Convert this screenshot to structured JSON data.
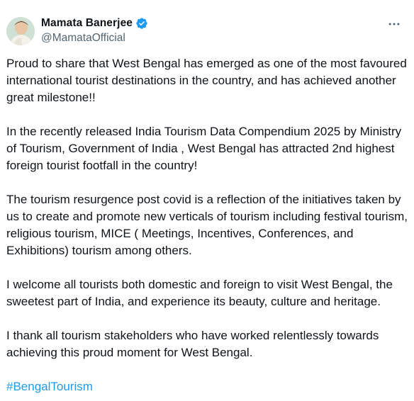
{
  "author": {
    "display_name": "Mamata Banerjee",
    "handle": "@MamataOfficial",
    "verified_color": "#1d9bf0"
  },
  "more_icon": "more-horizontal-icon",
  "tweet": {
    "paragraphs": [
      "Proud to share that West Bengal has emerged as one of the most favoured international tourist destinations in the country, and has achieved another great milestone!!",
      "In the recently released India Tourism Data Compendium 2025 by Ministry of Tourism, Government of India , West Bengal has attracted 2nd highest foreign tourist footfall in the country!",
      "The tourism resurgence post covid is a reflection of the initiatives taken by us to create and promote new verticals of tourism including festival tourism, religious tourism, MICE ( Meetings, Incentives, Conferences, and Exhibitions) tourism among others.",
      "I welcome all tourists both domestic and foreign to visit West Bengal, the sweetest part of India, and experience its beauty, culture and heritage.",
      "I thank all tourism stakeholders who have worked relentlessly towards achieving this proud moment for West Bengal."
    ],
    "hashtag": "#BengalTourism"
  }
}
